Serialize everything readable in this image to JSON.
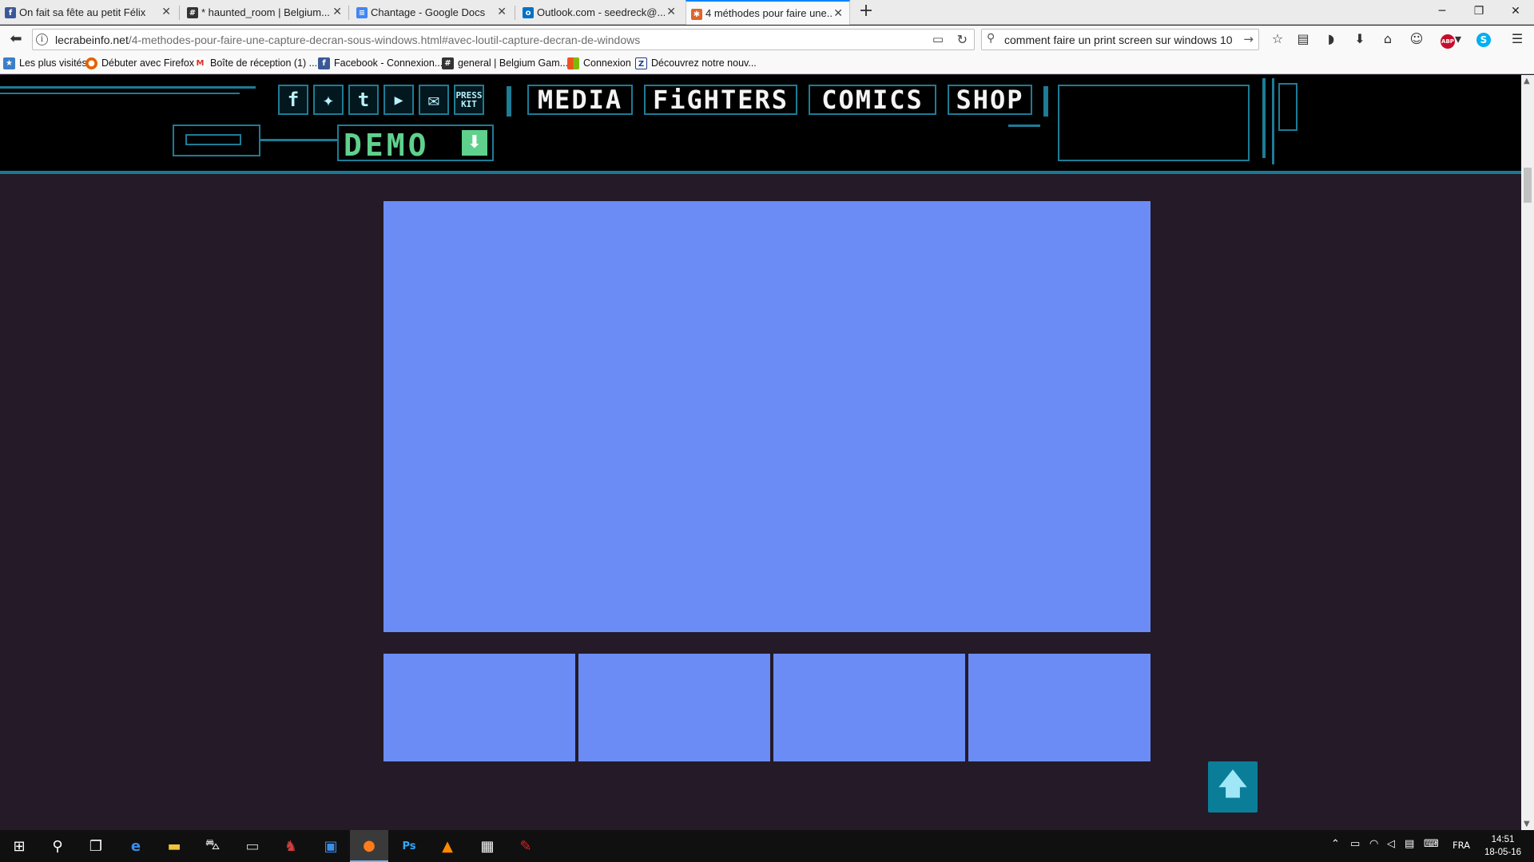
{
  "browser": {
    "tabs": [
      {
        "title": "On fait sa fête au petit Félix",
        "icon": "facebook-icon",
        "icon_glyph": "f",
        "icon_color": "#3b5998"
      },
      {
        "title": "* haunted_room | Belgium...",
        "icon": "slack-hash-icon",
        "icon_glyph": "#",
        "icon_color": "#333333"
      },
      {
        "title": "Chantage - Google Docs",
        "icon": "google-docs-icon",
        "icon_glyph": "≡",
        "icon_color": "#4285f4"
      },
      {
        "title": "Outlook.com - seedreck@...",
        "icon": "outlook-icon",
        "icon_glyph": "o",
        "icon_color": "#0072c6"
      },
      {
        "title": "4 méthodes pour faire une...",
        "icon": "crab-site-icon",
        "icon_glyph": "✱",
        "icon_color": "#e0642a"
      }
    ],
    "url_host": "lecrabeinfo.net",
    "url_path": "/4-methodes-pour-faire-une-capture-decran-sous-windows.html#avec-loutil-capture-decran-de-windows",
    "search_value": "comment faire un print screen sur windows 10",
    "bookmarks": [
      {
        "label": "Les plus visités",
        "glyph": "★",
        "color": "#3d7ec7"
      },
      {
        "label": "Débuter avec Firefox",
        "glyph": "●",
        "color": "#e66000"
      },
      {
        "label": "Boîte de réception (1) ...",
        "glyph": "M",
        "color": "#d93025"
      },
      {
        "label": "Facebook - Connexion...",
        "glyph": "f",
        "color": "#3b5998"
      },
      {
        "label": "general | Belgium Gam...",
        "glyph": "#",
        "color": "#333333"
      },
      {
        "label": "Connexion",
        "glyph": "▦",
        "color": "#f25022"
      },
      {
        "label": "Découvrez notre nouv...",
        "glyph": "Z",
        "color": "#1f3c88"
      }
    ]
  },
  "site": {
    "social": [
      {
        "name": "facebook-icon",
        "glyph": "f"
      },
      {
        "name": "twitter-icon",
        "glyph": "✦"
      },
      {
        "name": "tumblr-icon",
        "glyph": "t"
      },
      {
        "name": "youtube-icon",
        "glyph": "▶"
      },
      {
        "name": "mail-icon",
        "glyph": "✉"
      },
      {
        "name": "press-kit-icon",
        "glyph": "PRESS KIT"
      }
    ],
    "nav": [
      "MEDIA",
      "FiGHTERS",
      "COMICS",
      "SHOP"
    ],
    "demo_label": "DEMO",
    "demo_icon": "⬇",
    "back_to_top_icon": "🡅"
  },
  "taskbar": {
    "language": "FRA",
    "time": "14:51",
    "date": "18-05-16"
  }
}
